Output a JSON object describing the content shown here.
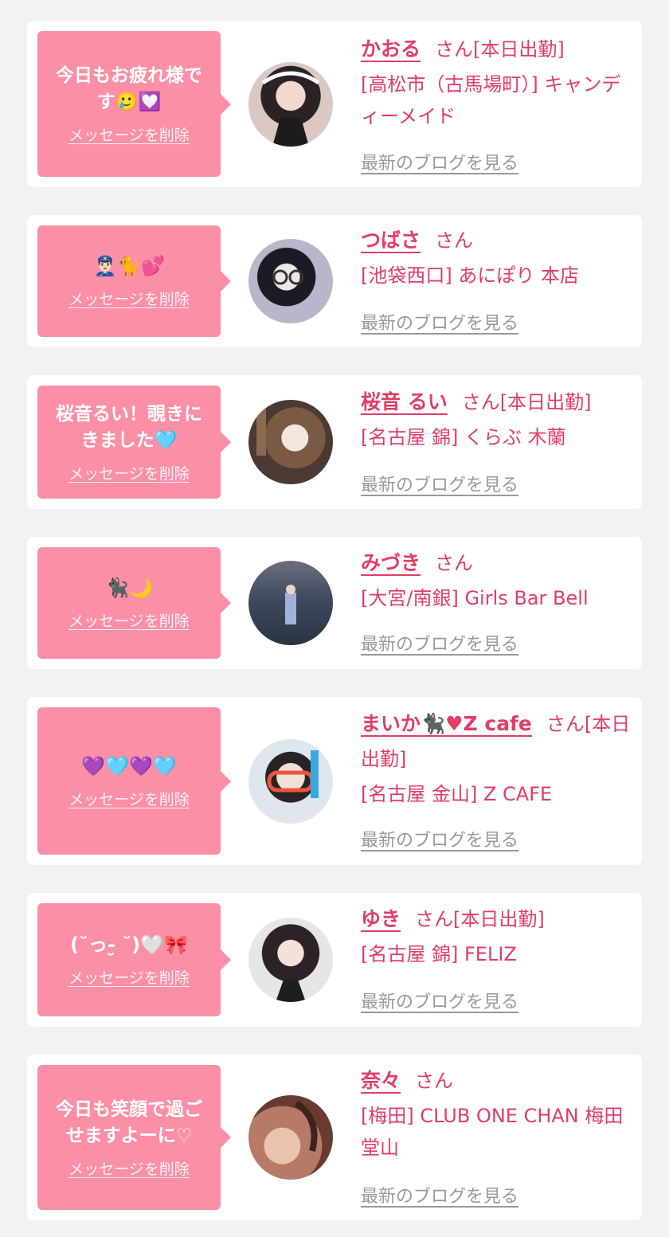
{
  "delete_label": "メッセージを削除",
  "blog_label": "最新のブログを見る",
  "san_label": "さん",
  "colors": {
    "accent": "#e23d66",
    "bubble": "#fb8fa5",
    "card": "#ffffff",
    "background": "#f2f2f2",
    "link_gray": "#999999"
  },
  "cards": [
    {
      "message": "今日もお疲れ様です🥲💟",
      "name": "かおる",
      "status": "[本日出勤]",
      "shop": "[高松市（古馬場町）] キャンディーメイド"
    },
    {
      "message": "👮🏻‍♂️🐈💕",
      "name": "つばさ",
      "status": "",
      "shop": "[池袋西口] あにぽり 本店"
    },
    {
      "message": "桜音るい！覗きにきました🩵",
      "name": "桜音 るい",
      "status": "[本日出勤]",
      "shop": "[名古屋 錦] くらぶ 木蘭"
    },
    {
      "message": "🐈‍⬛🌙",
      "name": "みづき",
      "status": "",
      "shop": "[大宮/南銀] Girls Bar Bell"
    },
    {
      "message": "💜🩵💜🩵",
      "name": "まいか🐈‍⬛♥Z cafe",
      "status": "[本日出勤]",
      "shop": "[名古屋 金山] Z CAFE"
    },
    {
      "message": "(˘っ-̮ ˘)🤍🎀",
      "name": "ゆき",
      "status": "[本日出勤]",
      "shop": "[名古屋 錦] FELIZ"
    },
    {
      "message": "今日も笑顔で過ごせますよーに♡",
      "name": "奈々",
      "status": "",
      "shop": "[梅田] CLUB ONE CHAN 梅田堂山"
    }
  ]
}
